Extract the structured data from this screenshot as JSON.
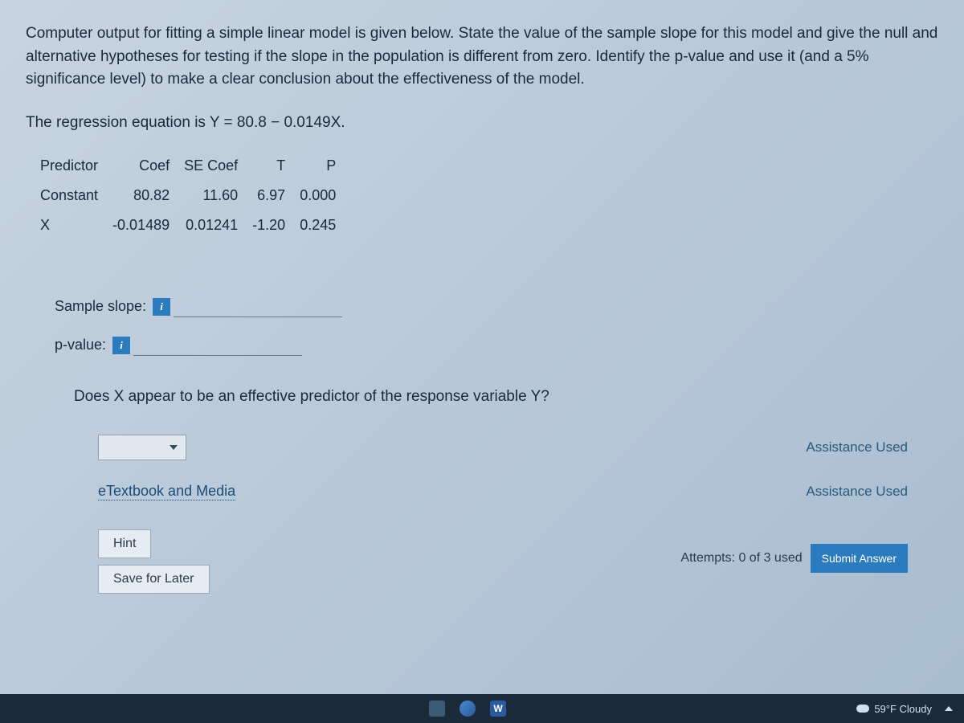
{
  "prompt": "Computer output for fitting a simple linear model is given below. State the value of the sample slope for this model and give the null and alternative hypotheses for testing if the slope in the population is different from zero. Identify the p-value and use it (and a 5% significance level) to make a clear conclusion about the effectiveness of the model.",
  "equation_prefix": "The regression equation is Y = ",
  "equation_value": "80.8 − 0.0149X.",
  "table": {
    "headers": [
      "Predictor",
      "Coef",
      "SE Coef",
      "T",
      "P"
    ],
    "rows": [
      {
        "predictor": "Constant",
        "coef": "80.82",
        "se": "11.60",
        "t": "6.97",
        "p": "0.000"
      },
      {
        "predictor": "X",
        "coef": "-0.01489",
        "se": "0.01241",
        "t": "-1.20",
        "p": "0.245"
      }
    ]
  },
  "answers": {
    "slope_label": "Sample slope:",
    "slope_value": "",
    "pvalue_label": "p-value:",
    "pvalue_value": "",
    "info_glyph": "i"
  },
  "question2": "Does X appear to be an effective predictor of the response variable Y?",
  "dropdown_selected": "",
  "assistance_used": "Assistance Used",
  "links": {
    "etextbook": "eTextbook and Media",
    "hint": "Hint",
    "save": "Save for Later"
  },
  "attempts": "Attempts: 0 of 3 used",
  "submit": "Submit Answer",
  "taskbar": {
    "word_glyph": "W",
    "weather": "59°F Cloudy"
  }
}
